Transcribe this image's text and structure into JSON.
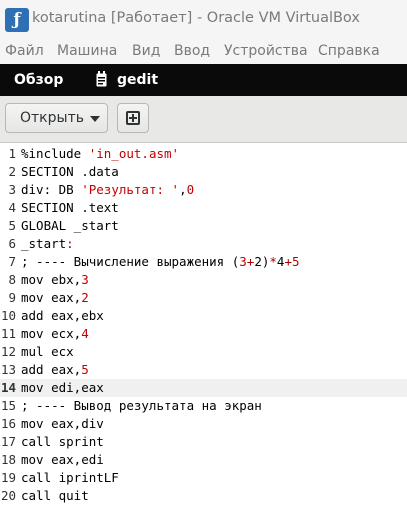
{
  "window": {
    "title": "kotarutina [Работает] - Oracle VM VirtualBox"
  },
  "menu": [
    "Файл",
    "Машина",
    "Вид",
    "Ввод",
    "Устройства",
    "Справка"
  ],
  "top_bar": {
    "overview": "Обзор",
    "app_name": "gedit"
  },
  "header_bar": {
    "open_label": "Открыть"
  },
  "editor": {
    "current_line": 14,
    "lines": [
      {
        "n": "1",
        "parts": [
          {
            "t": "%include "
          },
          {
            "t": "'in_out.asm'",
            "c": "str"
          }
        ]
      },
      {
        "n": "2",
        "parts": [
          {
            "t": "SECTION .data"
          }
        ]
      },
      {
        "n": "3",
        "parts": [
          {
            "t": "div: DB "
          },
          {
            "t": "'Результат: '",
            "c": "str"
          },
          {
            "t": ","
          },
          {
            "t": "0",
            "c": "num"
          }
        ]
      },
      {
        "n": "4",
        "parts": [
          {
            "t": "SECTION .text"
          }
        ]
      },
      {
        "n": "5",
        "parts": [
          {
            "t": "GLOBAL _start"
          }
        ]
      },
      {
        "n": "6",
        "parts": [
          {
            "t": "_start"
          },
          {
            "t": ":",
            "c": "op"
          }
        ]
      },
      {
        "n": "7",
        "parts": [
          {
            "t": "; ---- Вычисление выражения ("
          },
          {
            "t": "3",
            "c": "num"
          },
          {
            "t": "+",
            "c": "op"
          },
          {
            "t": "2"
          },
          {
            "t": ")"
          },
          {
            "t": "*",
            "c": "op"
          },
          {
            "t": "4"
          },
          {
            "t": "+",
            "c": "op"
          },
          {
            "t": "5",
            "c": "num"
          }
        ]
      },
      {
        "n": "8",
        "parts": [
          {
            "t": "mov ebx,"
          },
          {
            "t": "3",
            "c": "num"
          }
        ]
      },
      {
        "n": "9",
        "parts": [
          {
            "t": "mov eax,"
          },
          {
            "t": "2",
            "c": "num"
          }
        ]
      },
      {
        "n": "10",
        "parts": [
          {
            "t": "add eax,ebx"
          }
        ]
      },
      {
        "n": "11",
        "parts": [
          {
            "t": "mov ecx,"
          },
          {
            "t": "4",
            "c": "num"
          }
        ]
      },
      {
        "n": "12",
        "parts": [
          {
            "t": "mul ecx"
          }
        ]
      },
      {
        "n": "13",
        "parts": [
          {
            "t": "add eax,"
          },
          {
            "t": "5",
            "c": "num"
          }
        ]
      },
      {
        "n": "14",
        "parts": [
          {
            "t": "mov edi,eax"
          }
        ]
      },
      {
        "n": "15",
        "parts": [
          {
            "t": "; ---- Вывод результата на экран"
          }
        ]
      },
      {
        "n": "16",
        "parts": [
          {
            "t": "mov eax,div"
          }
        ]
      },
      {
        "n": "17",
        "parts": [
          {
            "t": "call sprint"
          }
        ]
      },
      {
        "n": "18",
        "parts": [
          {
            "t": "mov eax,edi"
          }
        ]
      },
      {
        "n": "19",
        "parts": [
          {
            "t": "call iprintLF"
          }
        ]
      },
      {
        "n": "20",
        "parts": [
          {
            "t": "call quit"
          }
        ]
      }
    ]
  },
  "colors": {
    "string": "#c00000",
    "number": "#c00000",
    "operator": "#a40000",
    "current_line": "#f0f0f0"
  },
  "icons": {
    "app": "virtualbox-icon",
    "gedit": "text-editor-icon",
    "new_document": "new-document-icon",
    "dropdown": "chevron-down-icon"
  }
}
